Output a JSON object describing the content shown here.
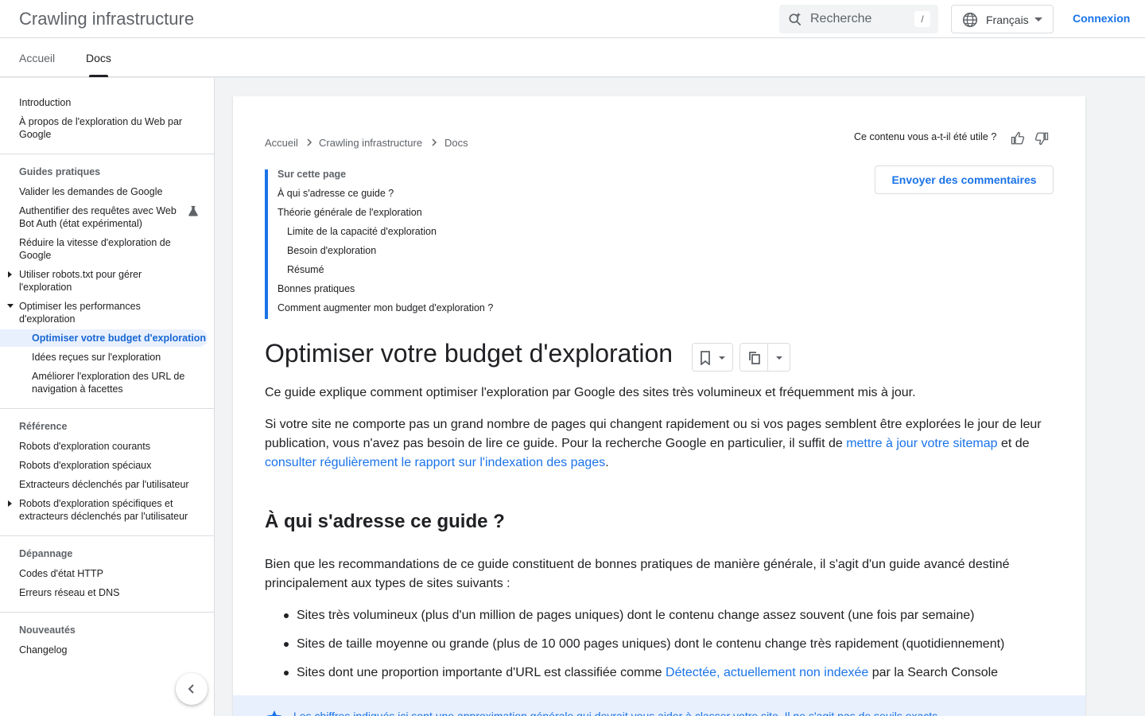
{
  "header": {
    "site_title": "Crawling infrastructure",
    "search_placeholder": "Recherche",
    "search_shortcut": "/",
    "language": "Français",
    "signin": "Connexion"
  },
  "tabs": [
    {
      "label": "Accueil",
      "active": false
    },
    {
      "label": "Docs",
      "active": true
    }
  ],
  "sidebar": {
    "intro": [
      "Introduction",
      "À propos de l'exploration du Web par Google"
    ],
    "guides_head": "Guides pratiques",
    "guides": [
      "Valider les demandes de Google",
      "Authentifier des requêtes avec Web Bot Auth (état expérimental)",
      "Réduire la vitesse d'exploration de Google",
      "Utiliser robots.txt pour gérer l'exploration",
      "Optimiser les performances d'exploration",
      "Optimiser votre budget d'exploration",
      "Idées reçues sur l'exploration",
      "Améliorer l'exploration des URL de navigation à facettes"
    ],
    "reference_head": "Référence",
    "reference": [
      "Robots d'exploration courants",
      "Robots d'exploration spéciaux",
      "Extracteurs déclenchés par l'utilisateur",
      "Robots d'exploration spécifiques et extracteurs déclenchés par l'utilisateur"
    ],
    "troubleshoot_head": "Dépannage",
    "troubleshoot": [
      "Codes d'état HTTP",
      "Erreurs réseau et DNS"
    ],
    "news_head": "Nouveautés",
    "news": [
      "Changelog"
    ]
  },
  "breadcrumb": [
    "Accueil",
    "Crawling infrastructure",
    "Docs"
  ],
  "helpful_question": "Ce contenu vous a-t-il été utile ?",
  "feedback_button": "Envoyer des commentaires",
  "toc": {
    "title": "Sur cette page",
    "items": [
      "À qui s'adresse ce guide ?",
      "Théorie générale de l'exploration",
      "Limite de la capacité d'exploration",
      "Besoin d'exploration",
      "Résumé",
      "Bonnes pratiques",
      "Comment augmenter mon budget d'exploration ?"
    ]
  },
  "article": {
    "title": "Optimiser votre budget d'exploration",
    "intro": "Ce guide explique comment optimiser l'exploration par Google des sites très volumineux et fréquemment mis à jour.",
    "p2_a": "Si votre site ne comporte pas un grand nombre de pages qui changent rapidement ou si vos pages semblent être explorées le jour de leur publication, vous n'avez pas besoin de lire ce guide. Pour la recherche Google en particulier, il suffit de ",
    "p2_link1": "mettre à jour votre sitemap",
    "p2_b": " et de ",
    "p2_link2": "consulter régulièrement le rapport sur l'indexation des pages",
    "p2_c": ".",
    "h2": "À qui s'adresse ce guide ?",
    "p3": "Bien que les recommandations de ce guide constituent de bonnes pratiques de manière générale, il s'agit d'un guide avancé destiné principalement aux types de sites suivants :",
    "bullets": [
      "Sites très volumineux (plus d'un million de pages uniques) dont le contenu change assez souvent (une fois par semaine)",
      "Sites de taille moyenne ou grande (plus de 10 000 pages uniques) dont le contenu change très rapidement (quotidiennement)"
    ],
    "b3_a": "Sites dont une proportion importante d'URL est classifiée comme ",
    "b3_link": "Détectée, actuellement non indexée",
    "b3_b": " par la Search Console",
    "note": "Les chiffres indiqués ici sont une approximation générale qui devrait vous aider à classer votre site. Il ne s'agit pas de seuils exacts."
  },
  "colors": {
    "accent": "#1a73e8",
    "active_bg": "#e8f0fe",
    "page_bg": "#f1f3f4"
  }
}
